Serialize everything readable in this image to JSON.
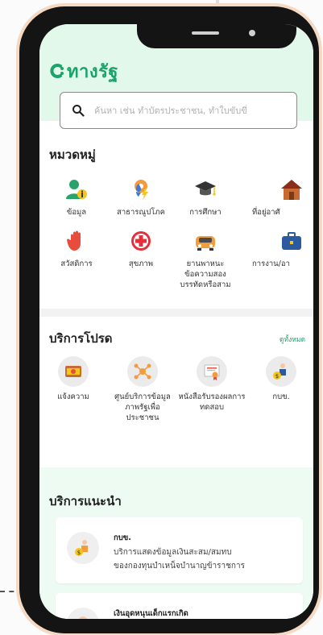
{
  "app": {
    "logo_text": "ทางรัฐ",
    "brand_color": "#1aa36c"
  },
  "search": {
    "placeholder": "ค้นหา เช่น ทำบัตรประชาชน, ทำใบขับขี่"
  },
  "categories": {
    "title": "หมวดหมู่",
    "items": [
      {
        "label": "ข้อมูล",
        "icon": "user-info-icon"
      },
      {
        "label": "สาธารณูปโภค",
        "icon": "utilities-icon"
      },
      {
        "label": "การศึกษา",
        "icon": "graduation-cap-icon"
      },
      {
        "label": "ที่อยู่อาศั",
        "icon": "house-icon"
      },
      {
        "label": "สวัสดิการ",
        "icon": "hand-icon"
      },
      {
        "label": "สุขภาพ",
        "icon": "health-cross-icon"
      },
      {
        "label": "ยานพาหนะข้อความสองบรรทัดหรือสาม",
        "icon": "car-icon"
      },
      {
        "label": "การงาน/อา",
        "icon": "briefcase-icon"
      }
    ]
  },
  "favorites": {
    "title": "บริการโปรด",
    "see_all": "ดูทั้งหมด",
    "items": [
      {
        "label": "แจ้งความ",
        "icon": "police-report-icon"
      },
      {
        "label": "ศูนย์บริการข้อมูลภาพรัฐเพื่อประชาชน",
        "icon": "network-icon"
      },
      {
        "label": "หนังสือรับรองผลการทดสอบ",
        "icon": "certificate-icon"
      },
      {
        "label": "กบข.",
        "icon": "pension-icon"
      }
    ]
  },
  "recommended": {
    "title": "บริการแนะนำ",
    "cards": [
      {
        "title": "กบข.",
        "desc_line1": "บริการแสดงข้อมูลเงินสะสม/สมทบ",
        "desc_line2": "ของกองทุนบำเหน็จบำนาญข้าราชการ",
        "icon": "pension-icon"
      },
      {
        "title": "เงินอุดหนุนเด็กแรกเกิด",
        "icon": "child-support-icon"
      }
    ]
  }
}
